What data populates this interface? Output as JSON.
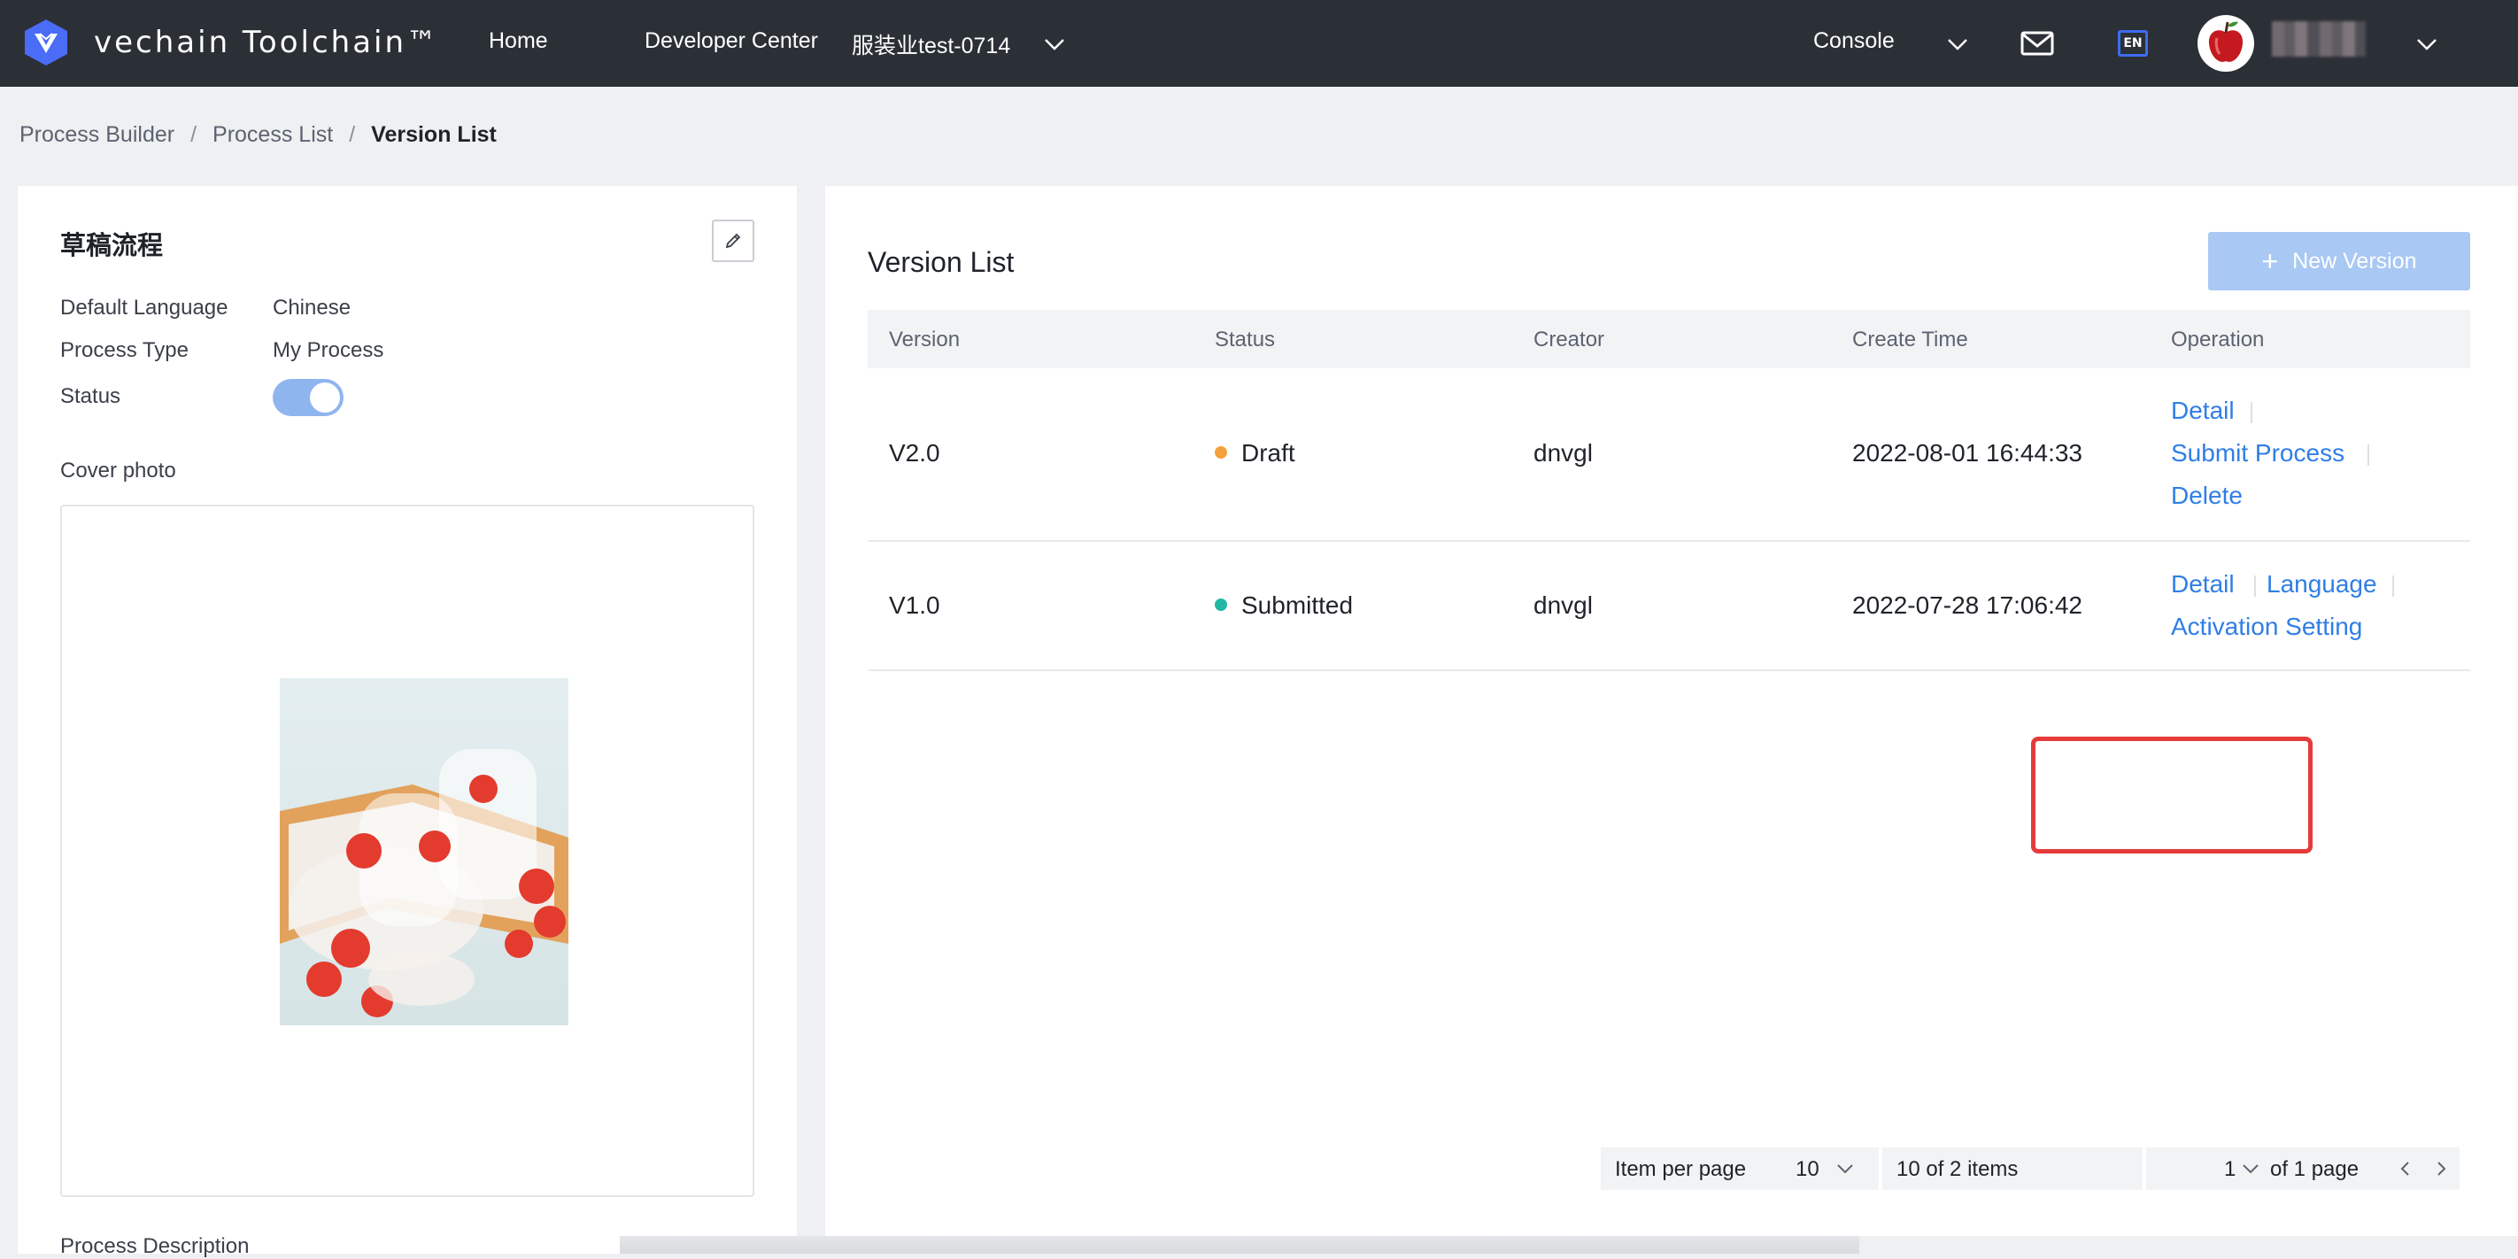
{
  "header": {
    "logo_text": "vechain Toolchain™",
    "nav": {
      "home": "Home",
      "developer_center": "Developer Center",
      "workspace": "服装业test-0714",
      "console": "Console"
    },
    "language_badge": "EN",
    "icons": [
      "vechain-logo-icon",
      "chevron-down-icon",
      "mail-icon",
      "language-icon",
      "avatar",
      "chevron-down-icon"
    ]
  },
  "breadcrumb": {
    "items": [
      "Process Builder",
      "Process List",
      "Version List"
    ],
    "separator": "/"
  },
  "process_info": {
    "title": "草稿流程",
    "default_language_label": "Default Language",
    "default_language_value": "Chinese",
    "process_type_label": "Process Type",
    "process_type_value": "My Process",
    "status_label": "Status",
    "status_enabled": true,
    "cover_photo_label": "Cover photo",
    "process_description_label": "Process Description"
  },
  "version_list": {
    "title": "Version List",
    "new_version_label": "New Version",
    "columns": [
      "Version",
      "Status",
      "Creator",
      "Create Time",
      "Operation"
    ],
    "rows": [
      {
        "version": "V2.0",
        "status": "Draft",
        "status_color": "#f5a13b",
        "creator": "dnvgl",
        "create_time": "2022-08-01 16:44:33",
        "operations": [
          "Detail",
          "Submit Process",
          "Delete"
        ]
      },
      {
        "version": "V1.0",
        "status": "Submitted",
        "status_color": "#22b8a4",
        "creator": "dnvgl",
        "create_time": "2022-07-28 17:06:42",
        "operations": [
          "Detail",
          "Language",
          "Activation Setting"
        ]
      }
    ]
  },
  "pagination": {
    "items_per_page_label": "Item per page",
    "items_per_page_value": "10",
    "range_text": "10 of 2 items",
    "current_page": "1",
    "total_pages_text": "of 1 page"
  },
  "colors": {
    "topbar": "#2b2f36",
    "link": "#2f7ee6",
    "primary_disabled": "#a9c8f4",
    "highlight": "#e63b3b"
  }
}
